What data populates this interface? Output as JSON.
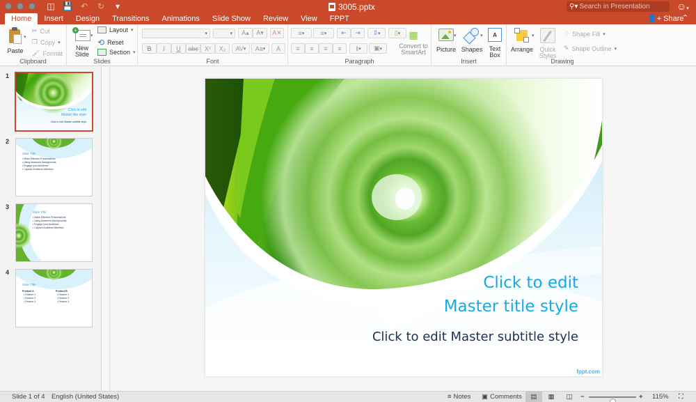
{
  "app": {
    "document_title": "3005.pptx",
    "accent_color": "#c9492a"
  },
  "titlebar": {
    "qat": [
      {
        "icon": "sidebar-toggle-icon"
      },
      {
        "icon": "save-icon"
      },
      {
        "icon": "undo-icon"
      },
      {
        "icon": "redo-icon"
      },
      {
        "icon": "customize-qat-icon"
      }
    ],
    "search_placeholder": "Search in Presentation",
    "share_label": "Share"
  },
  "tabs": [
    "Home",
    "Insert",
    "Design",
    "Transitions",
    "Animations",
    "Slide Show",
    "Review",
    "View",
    "FPPT"
  ],
  "active_tab": "Home",
  "ribbon": {
    "clipboard": {
      "label": "Clipboard",
      "paste": "Paste",
      "cut": "Cut",
      "copy": "Copy",
      "format": "Format"
    },
    "slides": {
      "label": "Slides",
      "new_slide_line1": "New",
      "new_slide_line2": "Slide",
      "layout": "Layout",
      "reset": "Reset",
      "section": "Section"
    },
    "font": {
      "label": "Font",
      "font_name": "",
      "font_size": "",
      "grow": "A▴",
      "shrink": "A▾",
      "bold": "B",
      "italic": "I",
      "underline": "U",
      "strike": "abc",
      "superscript": "X²",
      "subscript": "X₂",
      "spacing": "AV",
      "case": "Aa",
      "color": "A"
    },
    "paragraph": {
      "label": "Paragraph",
      "convert_line1": "Convert to",
      "convert_line2": "SmartArt"
    },
    "insert": {
      "label": "Insert",
      "picture": "Picture",
      "shapes": "Shapes",
      "textbox_line1": "Text",
      "textbox_line2": "Box"
    },
    "drawing": {
      "label": "Drawing",
      "arrange": "Arrange",
      "quick_styles_line1": "Quick",
      "quick_styles_line2": "Styles",
      "shape_fill": "Shape Fill",
      "shape_outline": "Shape Outline"
    }
  },
  "thumbnails": [
    {
      "number": "1",
      "title_line1": "Click to edit",
      "title_line2": "Master title style",
      "subtitle": "Click to edit Master subtitle style",
      "selected": true
    },
    {
      "number": "2",
      "title": "Slide Title",
      "bullets": [
        "Make Effective Presentations",
        "Using Awesome Backgrounds",
        "Engage your Audience",
        "Capture Audience Attention"
      ]
    },
    {
      "number": "3",
      "title": "Slide Title",
      "bullets": [
        "Make Effective Presentations",
        "Using Awesome Backgrounds",
        "Engage your Audience",
        "Capture Audience Attention"
      ]
    },
    {
      "number": "4",
      "title": "Slide Title",
      "col_a_head": "Product A",
      "col_b_head": "Product B",
      "col_a": [
        "Feature 1",
        "Feature 2",
        "Feature 3"
      ],
      "col_b": [
        "Feature 1",
        "Feature 2",
        "Feature 3"
      ]
    }
  ],
  "slide": {
    "title_line1": "Click to edit",
    "title_line2": "Master title style",
    "subtitle": "Click to edit Master subtitle style",
    "brand": "fppt.com",
    "title_color": "#19a9e3",
    "subtitle_color": "#1d2f52"
  },
  "status": {
    "slide_info": "Slide 1 of 4",
    "language": "English (United States)",
    "notes": "Notes",
    "comments": "Comments",
    "zoom_percent": "115%",
    "zoom_level_fraction": 0.5,
    "active_view": "normal"
  }
}
